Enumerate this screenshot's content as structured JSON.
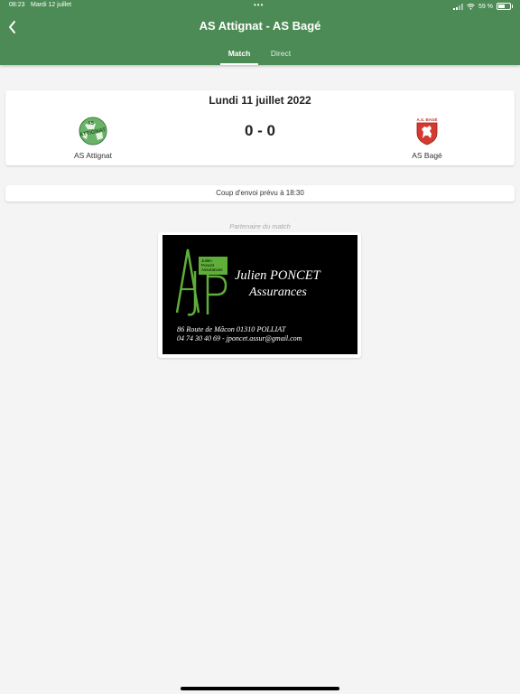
{
  "status_bar": {
    "time": "08:23",
    "date": "Mardi 12 juillet",
    "multitask_dots": "•••",
    "battery_label": "59 %"
  },
  "header": {
    "title": "AS Attignat - AS Bagé",
    "back_icon": "chevron-left-icon",
    "background_color": "#4c8b55",
    "tabs": [
      {
        "label": "Match",
        "active": true
      },
      {
        "label": "Direct",
        "active": false
      }
    ]
  },
  "match": {
    "date": "Lundi 11 juillet 2022",
    "score": "0 - 0",
    "home_team": {
      "name": "AS Attignat",
      "logo_text": "AS ATTIGNAT",
      "logo_icon": "green-ball-crest"
    },
    "away_team": {
      "name": "AS Bagé",
      "logo_text": "A.S. BAGÉ",
      "logo_icon": "red-lion-shield"
    }
  },
  "kickoff": {
    "text": "Coup d'envoi prévu à 18:30"
  },
  "partner": {
    "label": "Partenaire du match",
    "ad": {
      "monogram": "AJP",
      "monogram_tag": [
        "Julien",
        "Poncet",
        "Assurances"
      ],
      "name_line1": "Julien PONCET",
      "name_line2": "Assurances",
      "address": "86 Route de Mâcon 01310 POLLIAT",
      "contact": "04 74 30 40 69 - jponcet.assur@gmail.com"
    }
  }
}
